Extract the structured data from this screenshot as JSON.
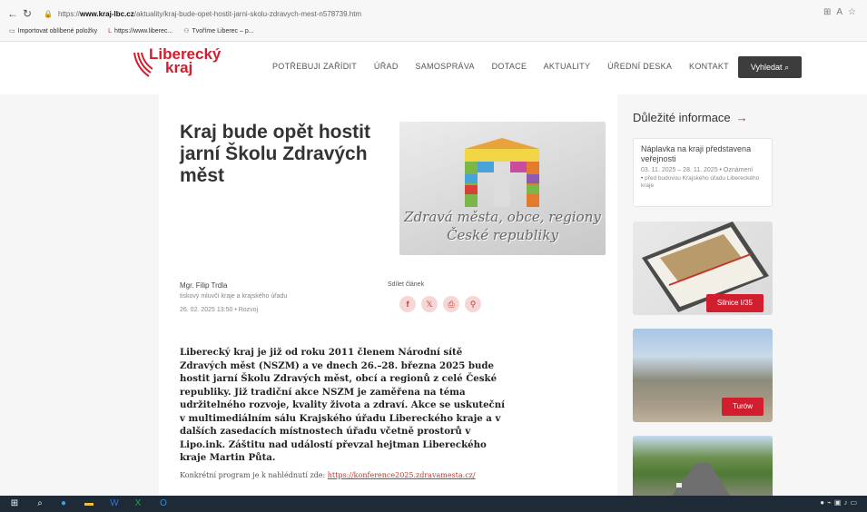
{
  "browser": {
    "url_prefix": "https://",
    "url_domain": "www.kraj-lbc.cz",
    "url_path": "/aktuality/kraj-bude-opet-hostit-jarni-skolu-zdravych-mest-n578739.htm",
    "bookmarks": [
      "Importovat oblíbené položky",
      "https://www.liberec...",
      "Tvoříme Liberec – p..."
    ]
  },
  "site": {
    "logo_line1": "Liberecký",
    "logo_line2": "kraj",
    "nav": [
      "POTŘEBUJI ZAŘÍDIT",
      "ÚŘAD",
      "SAMOSPRÁVA",
      "DOTACE",
      "AKTUALITY",
      "ÚŘEDNÍ DESKA",
      "KONTAKT"
    ],
    "search_label": "Vyhledat"
  },
  "article": {
    "title": "Kraj bude opět hostit jarní Školu Zdravých měst",
    "hero_caption_1": "Zdravá města, obce, regiony",
    "hero_caption_2": "České republiky",
    "author": "Mgr. Filip Trdla",
    "author_role": "tiskový mluvčí kraje a krajského úřadu",
    "meta": "26. 02. 2025 13:50 • Rozvoj",
    "share_label": "Sdílet článek",
    "lead": "Liberecký kraj je již od roku 2011 členem Národní sítě Zdravých měst (NSZM) a ve dnech 26.–28. března 2025 bude hostit jarní Školu Zdravých měst, obcí a regionů z celé České republiky. Již tradiční akce NSZM je zaměřena na téma udržitelného rozvoje, kvality života a zdraví. Akce se uskuteční v multimediálním sálu Krajského úřadu Libereckého kraje a v dalších zasedacích místnostech úřadu včetně prostorů v Lipo.ink. Záštitu nad událostí převzal hejtman Libereckého kraje Martin Půta.",
    "program_text": "Konkrétní program je k nahlédnutí zde:",
    "program_link": "https://konference2025.zdravamesta.cz/"
  },
  "sidebar": {
    "title": "Důležité informace",
    "info_title": "Náplavka na kraji představena veřejnosti",
    "info_date": "03. 11. 2025 – 28. 11. 2025 • Oznámení",
    "info_location": "před budovou Krajského úřadu Libereckého kraje",
    "tile1_label": "Silnice I/35",
    "tile2_label": "Turów"
  },
  "colors": {
    "brand_red": "#d21d2e",
    "search_bg": "#3d3d3d"
  }
}
